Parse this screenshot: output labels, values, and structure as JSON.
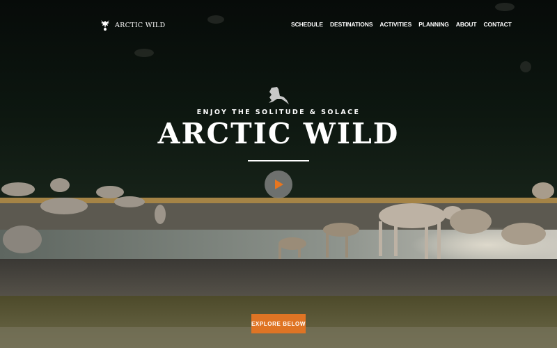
{
  "site": {
    "logo_text": "ARCTIC WILD"
  },
  "nav": {
    "items": [
      "SCHEDULE",
      "DESTINATIONS",
      "ACTIVITIES",
      "PLANNING",
      "ABOUT",
      "CONTACT"
    ]
  },
  "hero": {
    "tagline": "ENJOY THE SOLITUDE & SOLACE",
    "title": "ARCTIC WILD",
    "cta_label": "EXPLORE BELOW",
    "image_description_icon": "caribou-herd-river-photo"
  },
  "icons": {
    "logo": "caribou-logo-icon",
    "alaska": "alaska-map-icon",
    "play": "play-icon"
  },
  "colors": {
    "accent": "#df7424",
    "text": "#ffffff",
    "play_bg": "#8c8c8c"
  }
}
